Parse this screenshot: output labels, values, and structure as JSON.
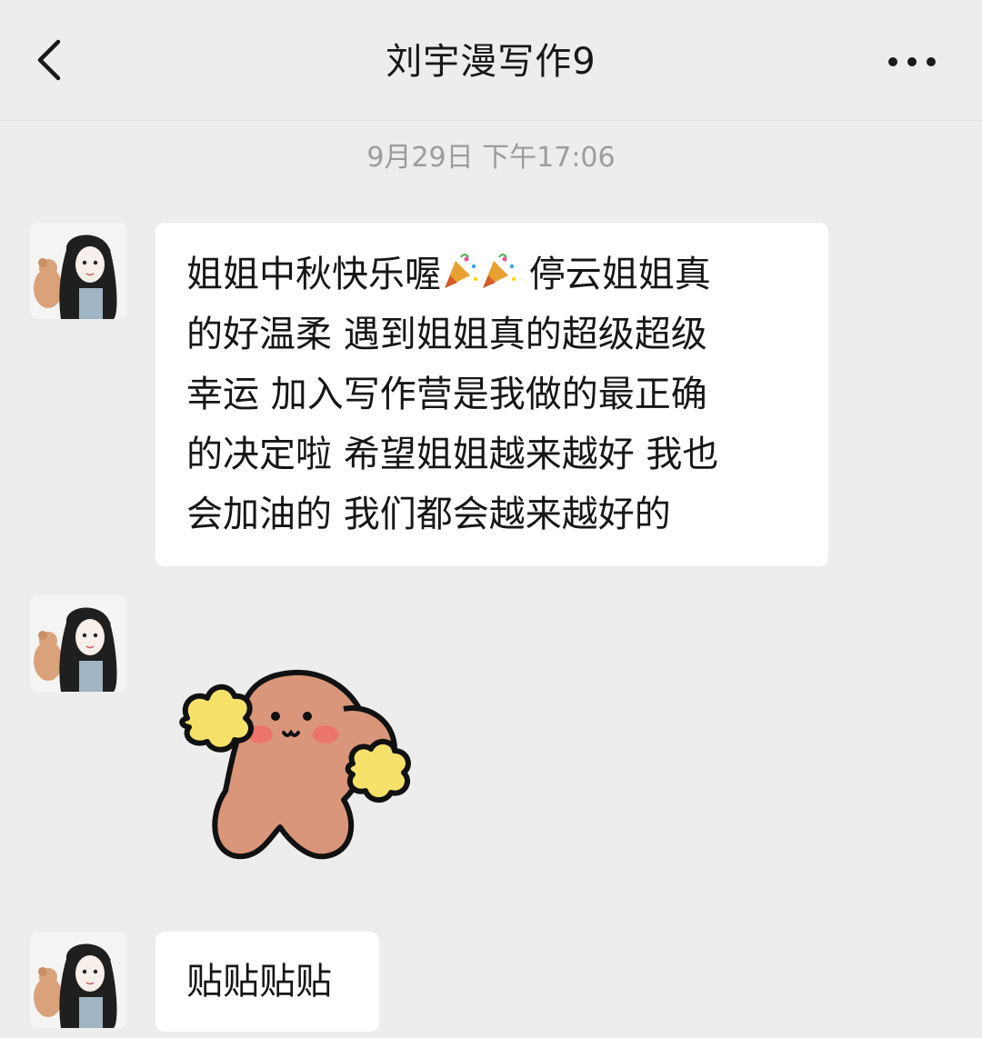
{
  "header": {
    "title": "刘宇漫写作9"
  },
  "conversation": {
    "timestamp": "9月29日 下午17:06",
    "messages": [
      {
        "type": "text",
        "lines": [
          {
            "before": "姐姐中秋快乐喔",
            "emoji": [
              "party-popper",
              "party-popper"
            ],
            "after": " 停云姐姐真"
          },
          {
            "text": "的好温柔 遇到姐姐真的超级超级"
          },
          {
            "text": "幸运 加入写作营是我做的最正确"
          },
          {
            "text": "的决定啦  希望姐姐越来越好 我也"
          },
          {
            "text": "会加油的 我们都会越来越好的"
          }
        ]
      },
      {
        "type": "sticker",
        "sticker": "cheering-puppy-sticker"
      },
      {
        "type": "text",
        "text": "贴贴贴贴"
      }
    ]
  },
  "icons": {
    "back": "chevron-left-icon",
    "more": "more-dots-icon",
    "emoji": "party-popper-icon"
  },
  "colors": {
    "background": "#ededed",
    "bubble": "#ffffff",
    "text": "#161616",
    "timestamp": "#9c9c9c"
  }
}
